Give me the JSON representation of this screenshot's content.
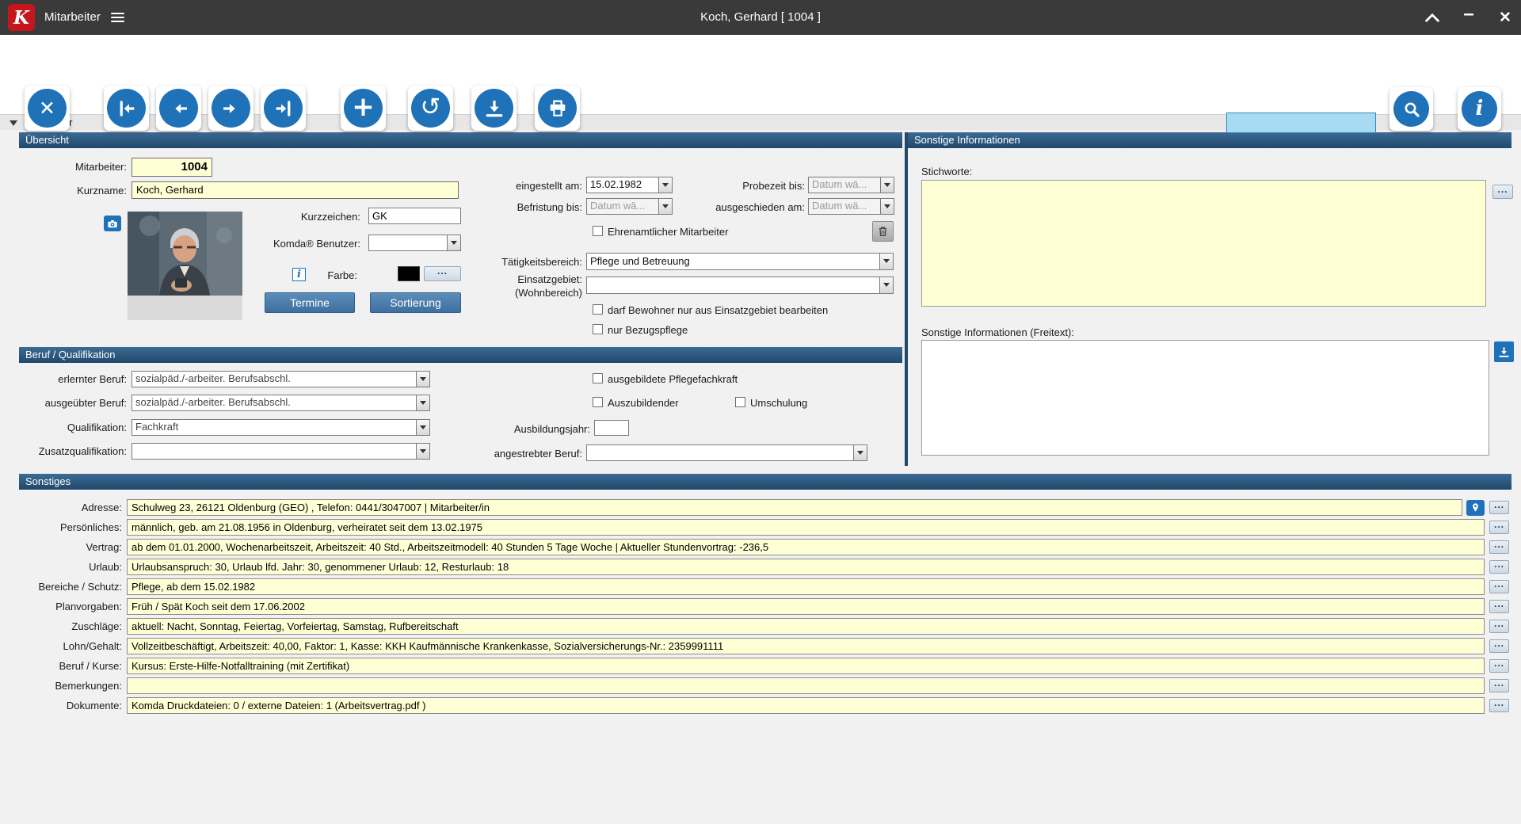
{
  "colors": {
    "accent_blue": "#1f72b8",
    "section_header": "#2b5b82",
    "field_yellow": "#ffffd6",
    "logo_red": "#c4161c",
    "titlebar": "#3a3a3a",
    "farbe_swatch": "#000000",
    "search_field": "#a8daf2"
  },
  "icons": {
    "logo": "K",
    "close_record": "✕",
    "add_record": "+",
    "undo": "↺",
    "info": "i",
    "window_minimize": "–",
    "window_close": "✕",
    "dots": "..."
  },
  "titlebar": {
    "app": "Mitarbeiter",
    "title": "Koch, Gerhard  [ 1004 ]"
  },
  "toolbar": {
    "search_value": ""
  },
  "collapse_bar": {
    "label": "Mitarbeiter"
  },
  "uebersicht": {
    "header": "Übersicht",
    "mitarbeiter_label": "Mitarbeiter:",
    "mitarbeiter_value": "1004",
    "kurzname_label": "Kurzname:",
    "kurzname_value": "Koch, Gerhard",
    "kurzzeichen_label": "Kurzzeichen:",
    "kurzzeichen_value": "GK",
    "benutzer_label": "Komda® Benutzer:",
    "benutzer_value": "",
    "farbe_label": "Farbe:",
    "termine": "Termine",
    "sortierung": "Sortierung",
    "eingestellt_label": "eingestellt am:",
    "eingestellt_value": "15.02.1982",
    "probezeit_label": "Probezeit bis:",
    "probezeit_placeholder": "Datum wä...",
    "befristung_label": "Befristung bis:",
    "befristung_placeholder": "Datum wä...",
    "ausgeschieden_label": "ausgeschieden am:",
    "ausgeschieden_placeholder": "Datum wä...",
    "ehrenamt_label": "Ehrenamtlicher Mitarbeiter",
    "taetigkeitsbereich_label": "Tätigkeitsbereich:",
    "taetigkeitsbereich_value": "Pflege und Betreuung",
    "einsatzgebiet_label": "Einsatzgebiet:",
    "einsatzgebiet_label2": "(Wohnbereich)",
    "check_einsatzgebiet": "darf Bewohner nur aus Einsatzgebiet bearbeiten",
    "check_bezugspflege": "nur Bezugspflege"
  },
  "beruf": {
    "header": "Beruf / Qualifikation",
    "rows": [
      {
        "label": "erlernter Beruf:",
        "value": "sozialpäd./-arbeiter. Berufsabschl."
      },
      {
        "label": "ausgeübter Beruf:",
        "value": "sozialpäd./-arbeiter. Berufsabschl."
      },
      {
        "label": "Qualifikation:",
        "value": "Fachkraft"
      },
      {
        "label": "Zusatzqualifikation:",
        "value": ""
      }
    ],
    "check_pflegefachkraft": "ausgebildete Pflegefachkraft",
    "check_auszubildender": "Auszubildender",
    "check_umschulung": "Umschulung",
    "ausbildungsjahr_label": "Ausbildungsjahr:",
    "ausbildungsjahr_value": "",
    "angestrebter_label": "angestrebter Beruf:",
    "angestrebter_value": ""
  },
  "right_panel": {
    "header": "Sonstige Informationen",
    "stichworte_label": "Stichworte:",
    "stichworte_value": "",
    "freitext_label": "Sonstige Informationen (Freitext):",
    "freitext_value": ""
  },
  "sonstiges": {
    "header": "Sonstiges",
    "rows": [
      {
        "label": "Adresse:",
        "value": "Schulweg 23, 26121 Oldenburg (GEO) , Telefon: 0441/3047007    |    Mitarbeiter/in"
      },
      {
        "label": "Persönliches:",
        "value": "männlich, geb. am 21.08.1956 in Oldenburg, verheiratet seit dem 13.02.1975"
      },
      {
        "label": "Vertrag:",
        "value": "ab dem 01.01.2000, Wochenarbeitszeit, Arbeitszeit: 40 Std., Arbeitszeitmodell: 40 Stunden 5 Tage Woche    |    Aktueller Stundenvortrag: -236,5"
      },
      {
        "label": "Urlaub:",
        "value": "Urlaubsanspruch: 30, Urlaub lfd. Jahr: 30, genommener Urlaub: 12, Resturlaub: 18"
      },
      {
        "label": "Bereiche / Schutz:",
        "value": "Pflege, ab dem 15.02.1982"
      },
      {
        "label": "Planvorgaben:",
        "value": "Früh / Spät Koch seit dem 17.06.2002"
      },
      {
        "label": "Zuschläge:",
        "value": "aktuell: Nacht, Sonntag, Feiertag, Vorfeiertag, Samstag, Rufbereitschaft"
      },
      {
        "label": "Lohn/Gehalt:",
        "value": "Vollzeitbeschäftigt, Arbeitszeit: 40,00, Faktor: 1, Kasse: KKH Kaufmännische Krankenkasse, Sozialversicherungs-Nr.: 2359991111"
      },
      {
        "label": "Beruf / Kurse:",
        "value": "Kursus: Erste-Hilfe-Notfalltraining (mit Zertifikat)"
      },
      {
        "label": "Bemerkungen:",
        "value": ""
      },
      {
        "label": "Dokumente:",
        "value": "Komda Druckdateien: 0 / externe Dateien: 1  (Arbeitsvertrag.pdf )"
      }
    ]
  }
}
